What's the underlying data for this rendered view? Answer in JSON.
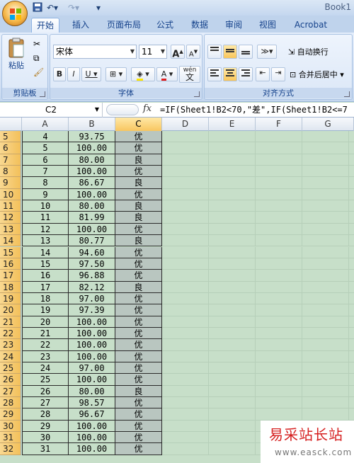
{
  "window": {
    "title": "Book1"
  },
  "quick_access": {
    "save_icon": "save-icon",
    "undo_icon": "undo-icon",
    "redo_icon": "redo-icon"
  },
  "tabs": [
    {
      "label": "开始",
      "active": true
    },
    {
      "label": "插入"
    },
    {
      "label": "页面布局"
    },
    {
      "label": "公式"
    },
    {
      "label": "数据"
    },
    {
      "label": "审阅"
    },
    {
      "label": "视图"
    },
    {
      "label": "Acrobat"
    }
  ],
  "ribbon": {
    "clipboard": {
      "label": "剪贴板",
      "paste_label": "粘贴"
    },
    "font": {
      "label": "字体",
      "font_name": "宋体",
      "font_size": "11",
      "bold": "B",
      "italic": "I",
      "underline": "U",
      "wen": "wén",
      "wen_char": "文",
      "grow": "A",
      "shrink": "A"
    },
    "alignment": {
      "label": "对齐方式",
      "wrap_text": "自动换行",
      "merge_center": "合并后居中"
    }
  },
  "formula_bar": {
    "name_box": "C2",
    "fx": "fx",
    "formula": "=IF(Sheet1!B2<70,\"差\",IF(Sheet1!B2<=7"
  },
  "columns": [
    "A",
    "B",
    "C",
    "D",
    "E",
    "F",
    "G"
  ],
  "selected_column": "C",
  "rows": [
    {
      "row": "5",
      "a": "4",
      "b": "93.75",
      "c": "优"
    },
    {
      "row": "6",
      "a": "5",
      "b": "100.00",
      "c": "优"
    },
    {
      "row": "7",
      "a": "6",
      "b": "80.00",
      "c": "良"
    },
    {
      "row": "8",
      "a": "7",
      "b": "100.00",
      "c": "优"
    },
    {
      "row": "9",
      "a": "8",
      "b": "86.67",
      "c": "良"
    },
    {
      "row": "10",
      "a": "9",
      "b": "100.00",
      "c": "优"
    },
    {
      "row": "11",
      "a": "10",
      "b": "80.00",
      "c": "良"
    },
    {
      "row": "12",
      "a": "11",
      "b": "81.99",
      "c": "良"
    },
    {
      "row": "13",
      "a": "12",
      "b": "100.00",
      "c": "优"
    },
    {
      "row": "14",
      "a": "13",
      "b": "80.77",
      "c": "良"
    },
    {
      "row": "15",
      "a": "14",
      "b": "94.60",
      "c": "优"
    },
    {
      "row": "16",
      "a": "15",
      "b": "97.50",
      "c": "优"
    },
    {
      "row": "17",
      "a": "16",
      "b": "96.88",
      "c": "优"
    },
    {
      "row": "18",
      "a": "17",
      "b": "82.12",
      "c": "良"
    },
    {
      "row": "19",
      "a": "18",
      "b": "97.00",
      "c": "优"
    },
    {
      "row": "20",
      "a": "19",
      "b": "97.39",
      "c": "优"
    },
    {
      "row": "21",
      "a": "20",
      "b": "100.00",
      "c": "优"
    },
    {
      "row": "22",
      "a": "21",
      "b": "100.00",
      "c": "优"
    },
    {
      "row": "23",
      "a": "22",
      "b": "100.00",
      "c": "优"
    },
    {
      "row": "24",
      "a": "23",
      "b": "100.00",
      "c": "优"
    },
    {
      "row": "25",
      "a": "24",
      "b": "97.00",
      "c": "优"
    },
    {
      "row": "26",
      "a": "25",
      "b": "100.00",
      "c": "优"
    },
    {
      "row": "27",
      "a": "26",
      "b": "80.00",
      "c": "良"
    },
    {
      "row": "28",
      "a": "27",
      "b": "98.57",
      "c": "优"
    },
    {
      "row": "29",
      "a": "28",
      "b": "96.67",
      "c": "优"
    },
    {
      "row": "30",
      "a": "29",
      "b": "100.00",
      "c": "优"
    },
    {
      "row": "31",
      "a": "30",
      "b": "100.00",
      "c": "优"
    },
    {
      "row": "32",
      "a": "31",
      "b": "100.00",
      "c": "优"
    }
  ],
  "watermark": {
    "title": "易采站长站",
    "url": "www.easck.com"
  },
  "colors": {
    "selected_column_header": "#f8c660",
    "grid_background": "#c7dfc9",
    "ribbon": "#dbe7f7"
  }
}
